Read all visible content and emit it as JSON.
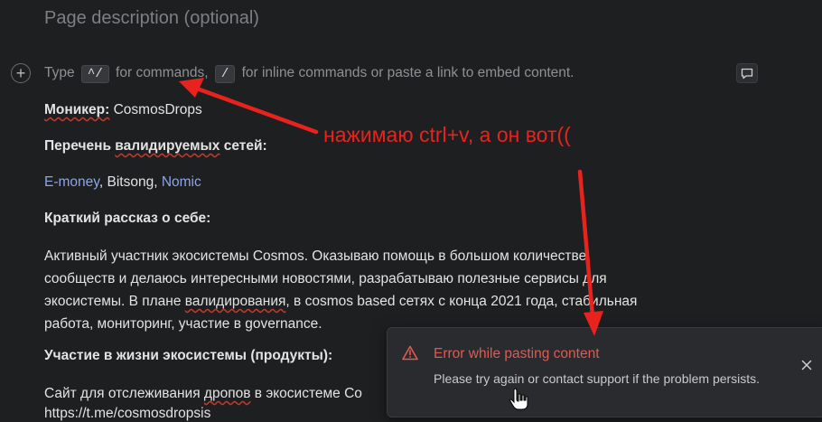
{
  "page_description_placeholder": "Page description (optional)",
  "editor": {
    "placeholder_pre": "Type",
    "kbd_commands": "^/",
    "placeholder_mid": "for commands,",
    "kbd_inline": "/",
    "placeholder_post": "for inline commands or paste a link to embed content."
  },
  "content": {
    "moniker_label": "Моникер:",
    "moniker_value": "CosmosDrops",
    "networks_pre": "Перечень",
    "networks_underlined": "валидируемых",
    "networks_post": "сетей:",
    "networks": [
      "E-money",
      "Bitsong",
      "Nomic"
    ],
    "networks_sep": ", ",
    "about_heading": "Краткий рассказ о себе:",
    "about_p1": "Активный участник экосистемы Cosmos. Оказываю помощь в большом количестве",
    "about_p2": "сообществ и делаюсь интересными новостями, разрабатываю полезные сервисы для",
    "about_p3_pre": "экосистемы. В плане",
    "about_p3_u": "валидирования",
    "about_p3_post": ", в cosmos based сетях с конца 2021 года, стабильная",
    "about_p4": "работа, мониторинг, участие в governance.",
    "participation_heading": "Участие в жизни экосистемы (продукты):",
    "site_pre": "Сайт для отслеживания",
    "site_u": "дропов",
    "site_post": "в экосистеме Co",
    "cut_line": "https://t.me/cosmosdropsis"
  },
  "annotation": {
    "text": "нажимаю ctrl+v, а он вот((",
    "color": "#e8231e"
  },
  "toast": {
    "title": "Error while pasting content",
    "message": "Please try again or contact support if the problem persists.",
    "close_icon": "close-icon",
    "warning_icon": "warning-triangle-icon",
    "accent": "#e05a52"
  }
}
